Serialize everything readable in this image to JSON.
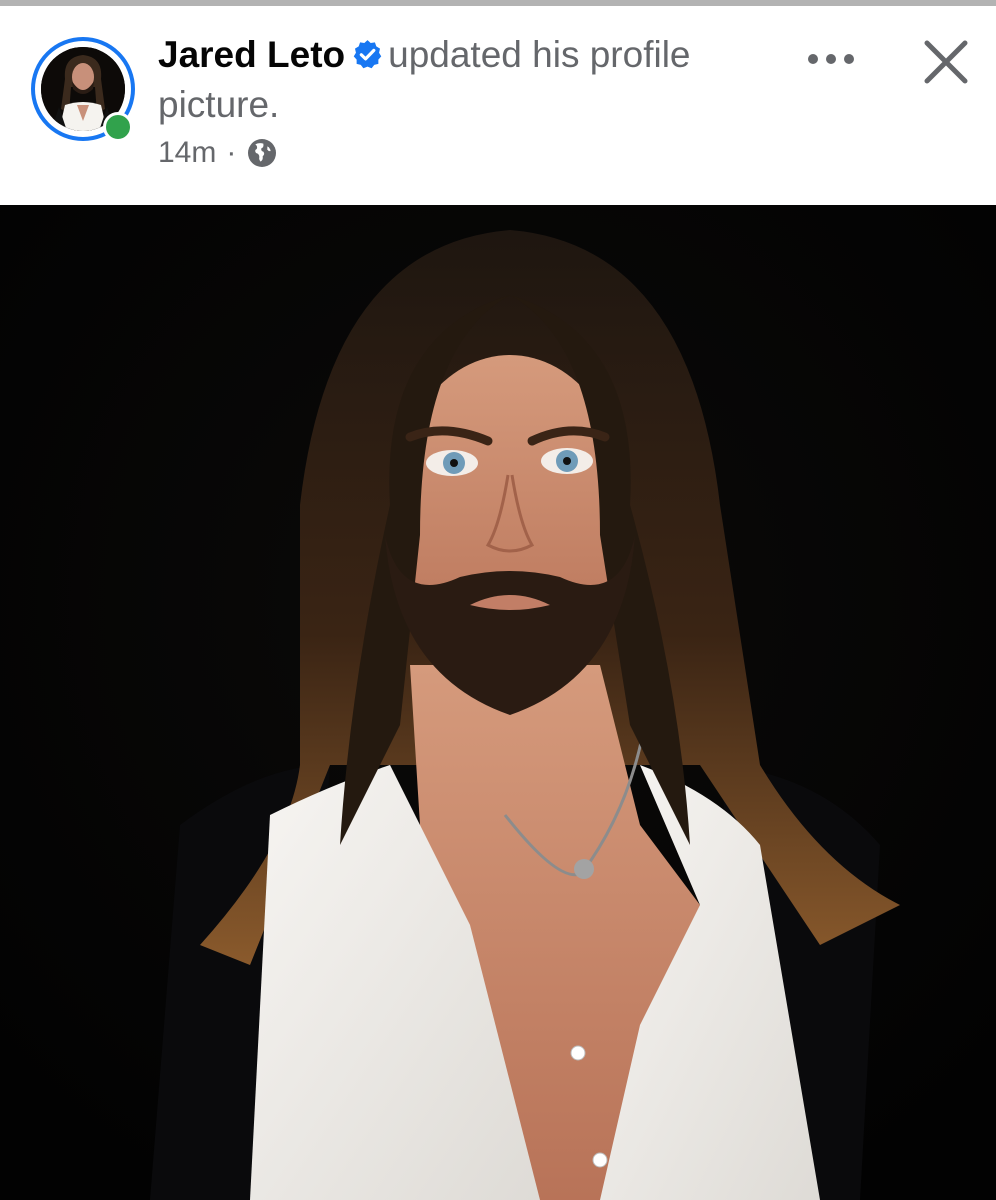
{
  "post": {
    "author": "Jared Leto",
    "action_text": "updated his profile picture.",
    "timestamp": "14m",
    "separator": "·",
    "privacy_icon": "globe-icon",
    "verified_icon": "verified-badge-icon",
    "online_status_color": "#31a24c",
    "ring_color": "#1877f2"
  },
  "actions": {
    "more_icon": "more-horizontal-icon",
    "close_icon": "close-icon"
  },
  "photo": {
    "subject": "profile-photo"
  }
}
